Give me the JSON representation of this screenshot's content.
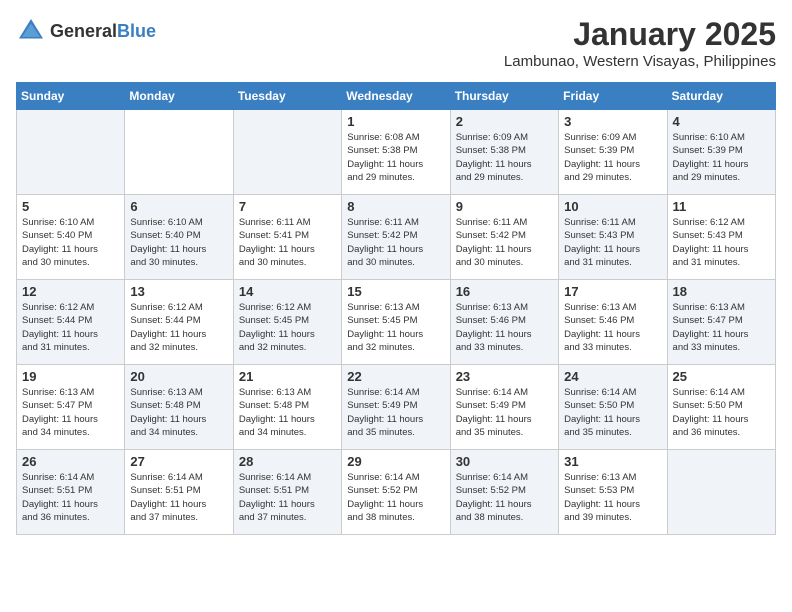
{
  "logo": {
    "text_general": "General",
    "text_blue": "Blue"
  },
  "header": {
    "month": "January 2025",
    "location": "Lambunao, Western Visayas, Philippines"
  },
  "weekdays": [
    "Sunday",
    "Monday",
    "Tuesday",
    "Wednesday",
    "Thursday",
    "Friday",
    "Saturday"
  ],
  "weeks": [
    [
      {
        "day": "",
        "info": ""
      },
      {
        "day": "",
        "info": ""
      },
      {
        "day": "",
        "info": ""
      },
      {
        "day": "1",
        "info": "Sunrise: 6:08 AM\nSunset: 5:38 PM\nDaylight: 11 hours\nand 29 minutes."
      },
      {
        "day": "2",
        "info": "Sunrise: 6:09 AM\nSunset: 5:38 PM\nDaylight: 11 hours\nand 29 minutes."
      },
      {
        "day": "3",
        "info": "Sunrise: 6:09 AM\nSunset: 5:39 PM\nDaylight: 11 hours\nand 29 minutes."
      },
      {
        "day": "4",
        "info": "Sunrise: 6:10 AM\nSunset: 5:39 PM\nDaylight: 11 hours\nand 29 minutes."
      }
    ],
    [
      {
        "day": "5",
        "info": "Sunrise: 6:10 AM\nSunset: 5:40 PM\nDaylight: 11 hours\nand 30 minutes."
      },
      {
        "day": "6",
        "info": "Sunrise: 6:10 AM\nSunset: 5:40 PM\nDaylight: 11 hours\nand 30 minutes."
      },
      {
        "day": "7",
        "info": "Sunrise: 6:11 AM\nSunset: 5:41 PM\nDaylight: 11 hours\nand 30 minutes."
      },
      {
        "day": "8",
        "info": "Sunrise: 6:11 AM\nSunset: 5:42 PM\nDaylight: 11 hours\nand 30 minutes."
      },
      {
        "day": "9",
        "info": "Sunrise: 6:11 AM\nSunset: 5:42 PM\nDaylight: 11 hours\nand 30 minutes."
      },
      {
        "day": "10",
        "info": "Sunrise: 6:11 AM\nSunset: 5:43 PM\nDaylight: 11 hours\nand 31 minutes."
      },
      {
        "day": "11",
        "info": "Sunrise: 6:12 AM\nSunset: 5:43 PM\nDaylight: 11 hours\nand 31 minutes."
      }
    ],
    [
      {
        "day": "12",
        "info": "Sunrise: 6:12 AM\nSunset: 5:44 PM\nDaylight: 11 hours\nand 31 minutes."
      },
      {
        "day": "13",
        "info": "Sunrise: 6:12 AM\nSunset: 5:44 PM\nDaylight: 11 hours\nand 32 minutes."
      },
      {
        "day": "14",
        "info": "Sunrise: 6:12 AM\nSunset: 5:45 PM\nDaylight: 11 hours\nand 32 minutes."
      },
      {
        "day": "15",
        "info": "Sunrise: 6:13 AM\nSunset: 5:45 PM\nDaylight: 11 hours\nand 32 minutes."
      },
      {
        "day": "16",
        "info": "Sunrise: 6:13 AM\nSunset: 5:46 PM\nDaylight: 11 hours\nand 33 minutes."
      },
      {
        "day": "17",
        "info": "Sunrise: 6:13 AM\nSunset: 5:46 PM\nDaylight: 11 hours\nand 33 minutes."
      },
      {
        "day": "18",
        "info": "Sunrise: 6:13 AM\nSunset: 5:47 PM\nDaylight: 11 hours\nand 33 minutes."
      }
    ],
    [
      {
        "day": "19",
        "info": "Sunrise: 6:13 AM\nSunset: 5:47 PM\nDaylight: 11 hours\nand 34 minutes."
      },
      {
        "day": "20",
        "info": "Sunrise: 6:13 AM\nSunset: 5:48 PM\nDaylight: 11 hours\nand 34 minutes."
      },
      {
        "day": "21",
        "info": "Sunrise: 6:13 AM\nSunset: 5:48 PM\nDaylight: 11 hours\nand 34 minutes."
      },
      {
        "day": "22",
        "info": "Sunrise: 6:14 AM\nSunset: 5:49 PM\nDaylight: 11 hours\nand 35 minutes."
      },
      {
        "day": "23",
        "info": "Sunrise: 6:14 AM\nSunset: 5:49 PM\nDaylight: 11 hours\nand 35 minutes."
      },
      {
        "day": "24",
        "info": "Sunrise: 6:14 AM\nSunset: 5:50 PM\nDaylight: 11 hours\nand 35 minutes."
      },
      {
        "day": "25",
        "info": "Sunrise: 6:14 AM\nSunset: 5:50 PM\nDaylight: 11 hours\nand 36 minutes."
      }
    ],
    [
      {
        "day": "26",
        "info": "Sunrise: 6:14 AM\nSunset: 5:51 PM\nDaylight: 11 hours\nand 36 minutes."
      },
      {
        "day": "27",
        "info": "Sunrise: 6:14 AM\nSunset: 5:51 PM\nDaylight: 11 hours\nand 37 minutes."
      },
      {
        "day": "28",
        "info": "Sunrise: 6:14 AM\nSunset: 5:51 PM\nDaylight: 11 hours\nand 37 minutes."
      },
      {
        "day": "29",
        "info": "Sunrise: 6:14 AM\nSunset: 5:52 PM\nDaylight: 11 hours\nand 38 minutes."
      },
      {
        "day": "30",
        "info": "Sunrise: 6:14 AM\nSunset: 5:52 PM\nDaylight: 11 hours\nand 38 minutes."
      },
      {
        "day": "31",
        "info": "Sunrise: 6:13 AM\nSunset: 5:53 PM\nDaylight: 11 hours\nand 39 minutes."
      },
      {
        "day": "",
        "info": ""
      }
    ]
  ]
}
